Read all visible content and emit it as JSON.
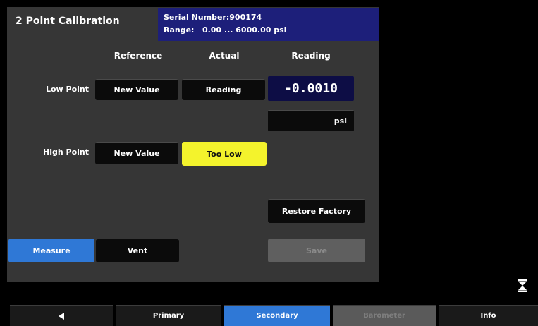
{
  "title": "2 Point Calibration",
  "serial": {
    "serial_line": "Serial Number:900174",
    "range_line": "Range:   0.00 ... 6000.00 psi"
  },
  "columns": {
    "reference": "Reference",
    "actual": "Actual",
    "reading": "Reading"
  },
  "rows": {
    "low_point": {
      "label": "Low Point",
      "reference_button": "New Value",
      "actual_button": "Reading"
    },
    "high_point": {
      "label": "High Point",
      "reference_button": "New Value",
      "actual_button": "Too Low"
    }
  },
  "reading": {
    "value": "-0.0010",
    "unit": "psi"
  },
  "buttons": {
    "restore_factory": "Restore Factory",
    "measure": "Measure",
    "vent": "Vent",
    "save": "Save"
  },
  "tabs": {
    "back_icon": "back-arrow-icon",
    "primary": "Primary",
    "secondary": "Secondary",
    "barometer": "Barometer",
    "info": "Info"
  },
  "colors": {
    "accent_blue": "#2f78d6",
    "warning_yellow": "#f4f32c",
    "header_navy": "#1d1f7a"
  }
}
